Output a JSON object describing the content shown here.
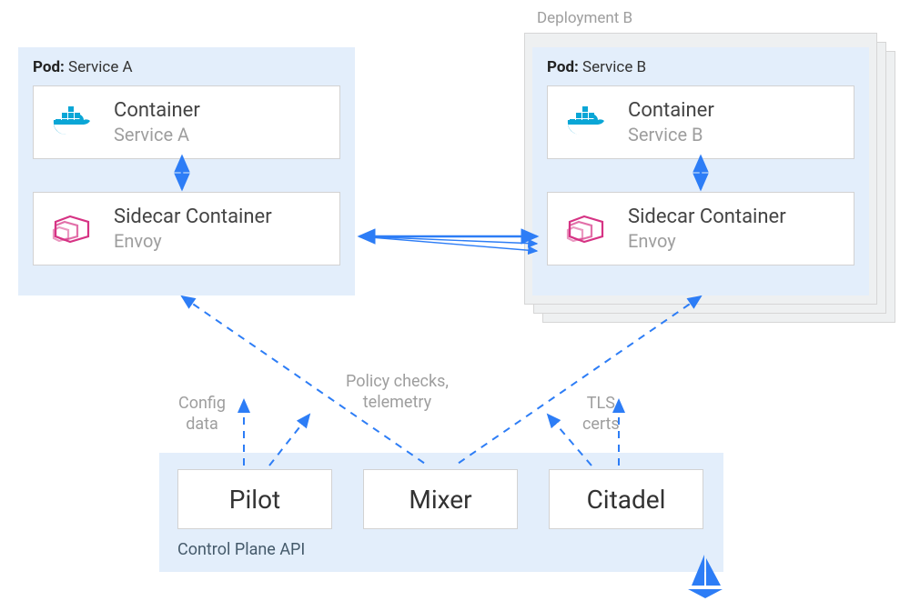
{
  "deployment": {
    "label": "Deployment B"
  },
  "podA": {
    "titlePrefix": "Pod:",
    "titleName": "Service A",
    "container": {
      "title": "Container",
      "sub": "Service A"
    },
    "sidecar": {
      "title": "Sidecar Container",
      "sub": "Envoy"
    }
  },
  "podB": {
    "titlePrefix": "Pod:",
    "titleName": "Service B",
    "container": {
      "title": "Container",
      "sub": "Service B"
    },
    "sidecar": {
      "title": "Sidecar Container",
      "sub": "Envoy"
    }
  },
  "controlPlane": {
    "pilot": "Pilot",
    "mixer": "Mixer",
    "citadel": "Citadel",
    "label": "Control Plane API"
  },
  "annotations": {
    "config": "Config\ndata",
    "policy": "Policy checks,\ntelemetry",
    "tls": "TLS\ncerts"
  },
  "colors": {
    "blue": "#2d7df6",
    "podBg": "#e3eefb",
    "grey": "#9e9e9e",
    "envoyPink": "#d63384",
    "dockerBlue": "#0aa6d6"
  }
}
